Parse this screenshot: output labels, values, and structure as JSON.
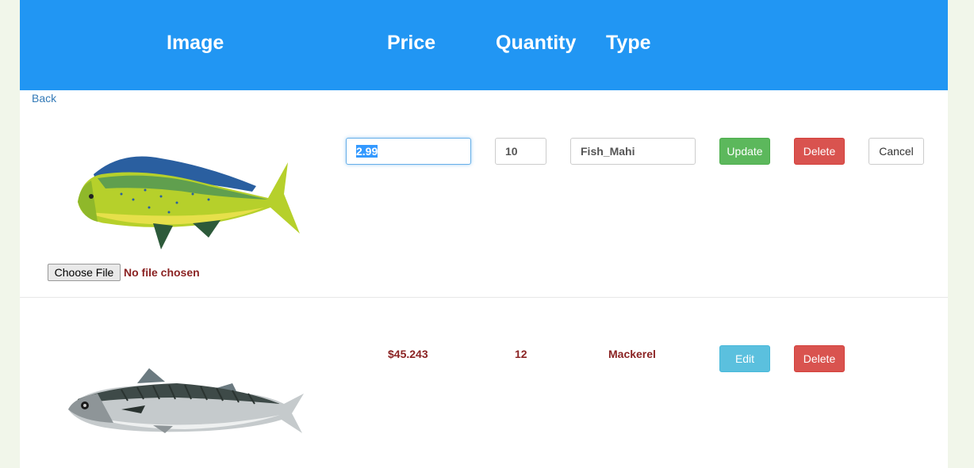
{
  "header": {
    "image": "Image",
    "price": "Price",
    "quantity": "Quantity",
    "type": "Type"
  },
  "back_link": "Back",
  "edit_row": {
    "image_alt": "mahi-mahi fish",
    "price_value": "2.99",
    "quantity_value": "10",
    "type_value": "Fish_Mahi",
    "update_label": "Update",
    "delete_label": "Delete",
    "cancel_label": "Cancel",
    "choose_file_label": "Choose File",
    "file_status": "No file chosen"
  },
  "rows": [
    {
      "image_alt": "mackerel fish",
      "price": "$45.243",
      "quantity": "12",
      "type": "Mackerel",
      "edit_label": "Edit",
      "delete_label": "Delete"
    }
  ],
  "colors": {
    "header_bg": "#2196f3",
    "accent_text": "#8b2323",
    "update": "#5cb85c",
    "delete": "#d9534f",
    "edit": "#5bc0de"
  }
}
